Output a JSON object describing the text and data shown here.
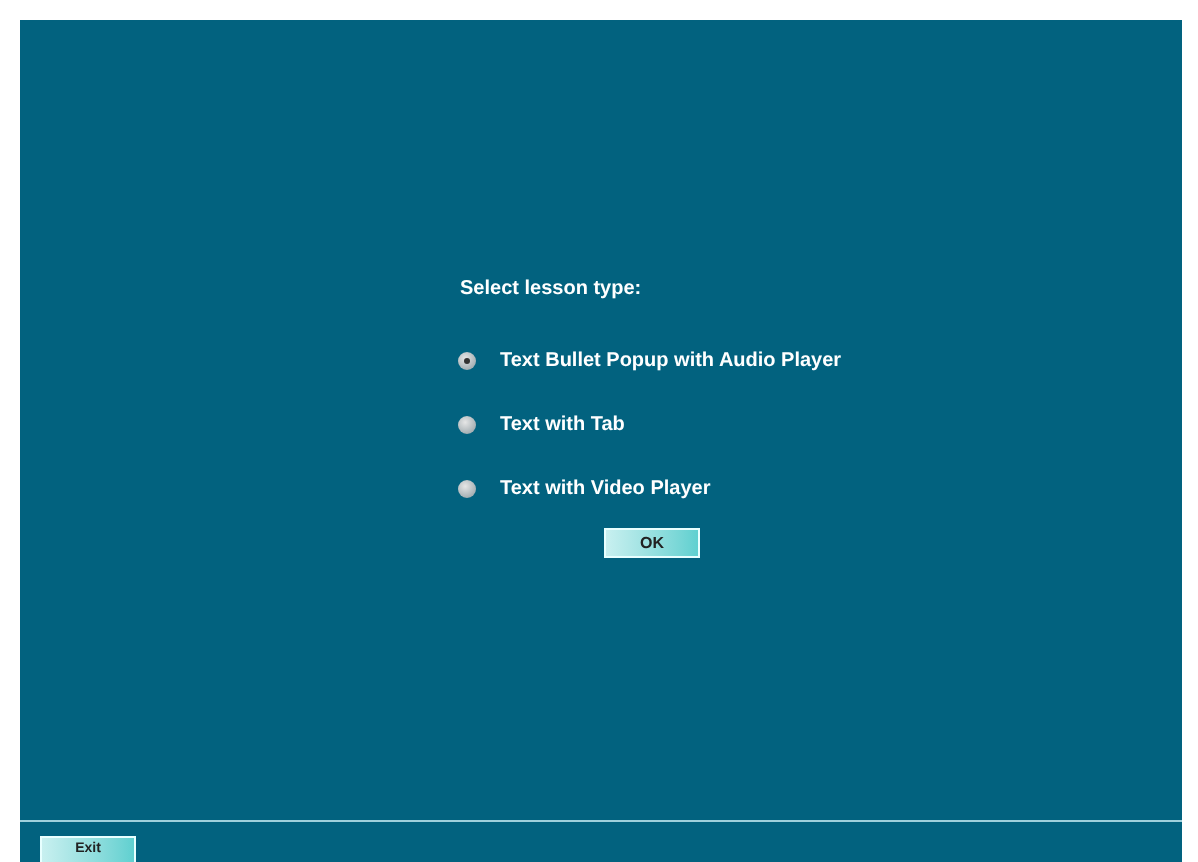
{
  "prompt": "Select lesson type:",
  "options": [
    {
      "label": "Text Bullet Popup with Audio Player",
      "selected": true
    },
    {
      "label": "Text with Tab",
      "selected": false
    },
    {
      "label": "Text with Video Player",
      "selected": false
    }
  ],
  "ok_button": "OK",
  "exit_button": "Exit"
}
